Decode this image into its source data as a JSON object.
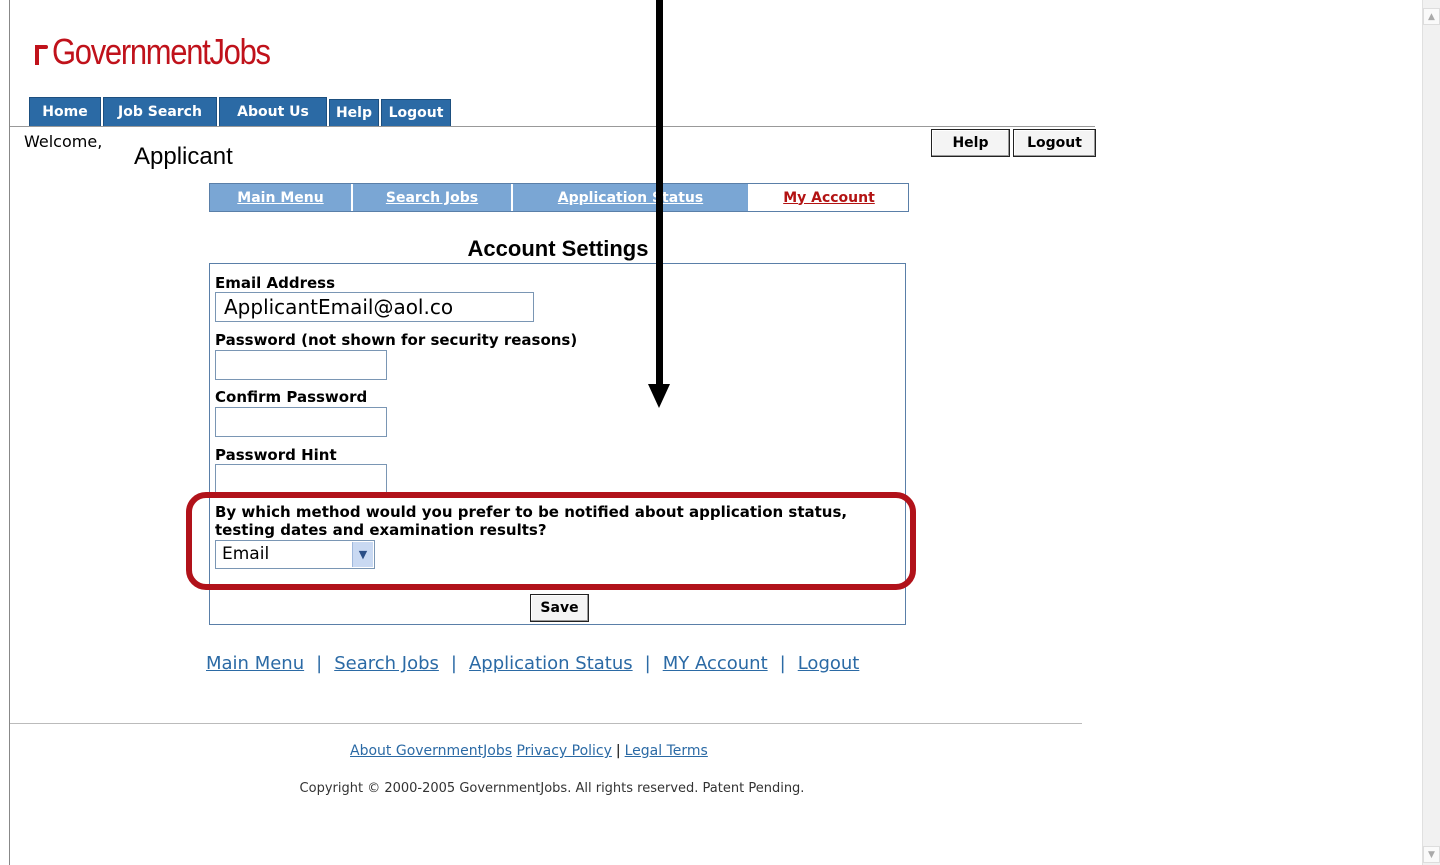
{
  "logo": {
    "text": "GovernmentJobs"
  },
  "top_tabs": [
    "Home",
    "Job Search",
    "About Us",
    "Help",
    "Logout"
  ],
  "welcome": {
    "label": "Welcome,",
    "name": "Applicant"
  },
  "util_buttons": {
    "help": "Help",
    "logout": "Logout"
  },
  "sub_tabs": [
    "Main Menu",
    "Search Jobs",
    "Application Status",
    "My Account"
  ],
  "form": {
    "title": "Account Settings",
    "email_label": "Email Address",
    "email_value": "ApplicantEmail@aol.co",
    "password_label": "Password (not shown for security reasons)",
    "confirm_label": "Confirm Password",
    "hint_label": "Password Hint",
    "notify_question": "By which method would you prefer to be notified about application status, testing dates and examination results?",
    "notify_selected": "Email",
    "save_label": "Save"
  },
  "bottom_links": [
    "Main Menu",
    "Search Jobs",
    "Application Status",
    "MY Account",
    "Logout"
  ],
  "footer": {
    "links": [
      "About GovernmentJobs",
      "Privacy Policy",
      "Legal Terms"
    ],
    "copyright": "Copyright © 2000-2005 GovernmentJobs. All rights reserved. Patent Pending."
  },
  "colors": {
    "brand": "#c0121b",
    "tab_blue": "#2b6aa5",
    "subtab_blue": "#7aa6d4",
    "highlight": "#b1121a"
  }
}
